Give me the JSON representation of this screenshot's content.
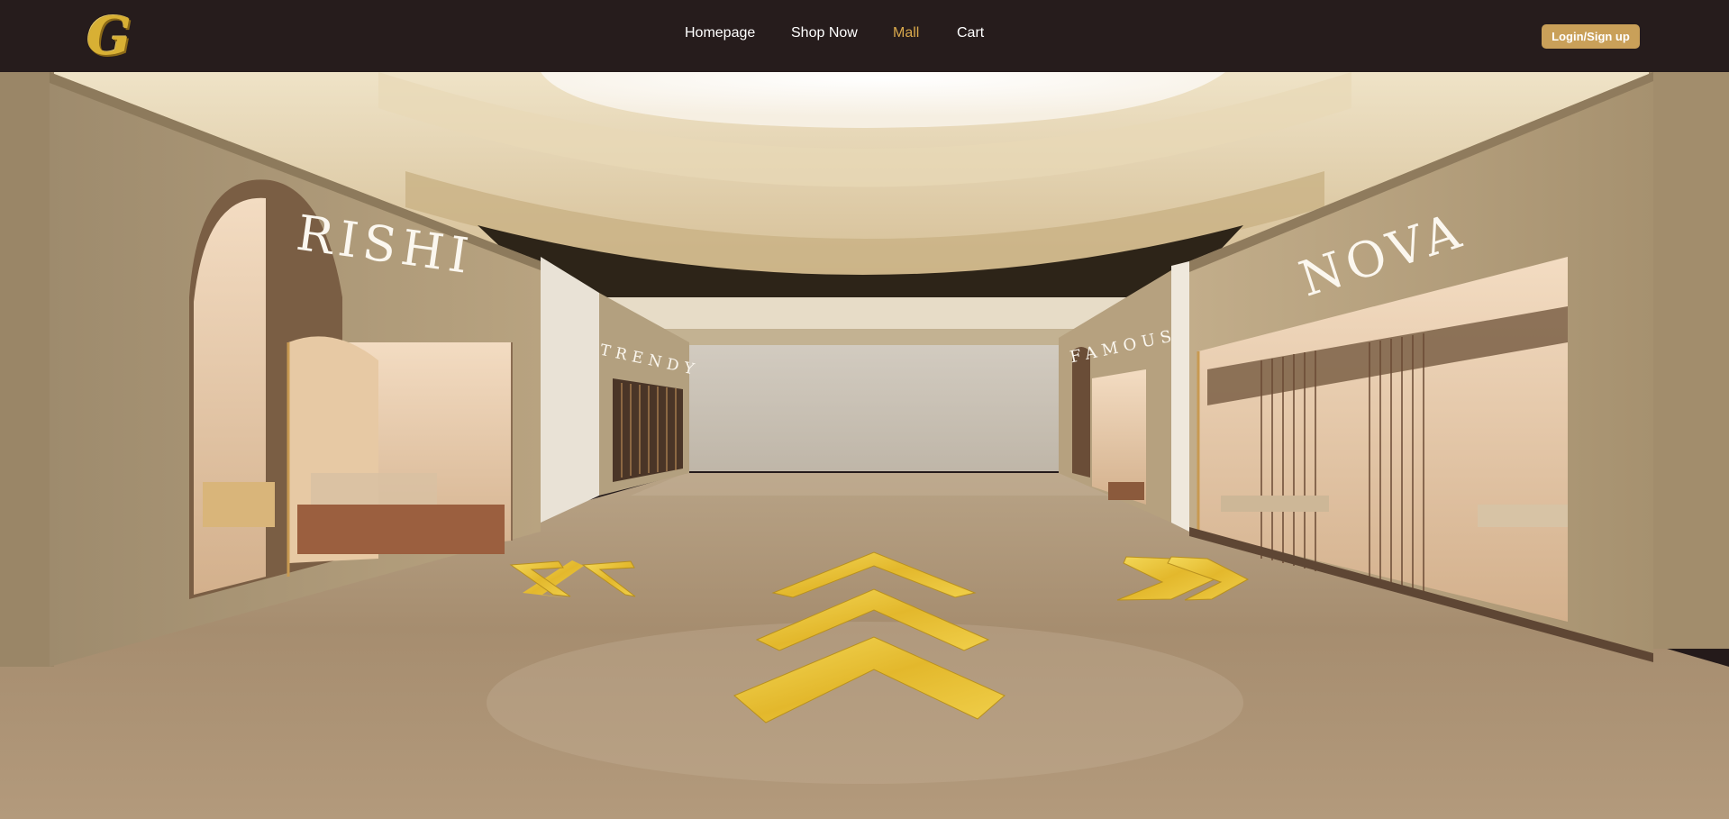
{
  "header": {
    "logo_letter": "G",
    "nav": {
      "homepage": "Homepage",
      "shop_now": "Shop Now",
      "mall": "Mall",
      "cart": "Cart"
    },
    "active_nav": "Mall",
    "login_label": "Login/Sign up"
  },
  "stores": {
    "left_front": "RISHI",
    "left_back": "TRENDY",
    "right_back": "FAMOUS",
    "right_front": "NOVA"
  },
  "colors": {
    "header_bg": "#261c1c",
    "accent_gold": "#c9a059",
    "active_nav": "#d9a94c",
    "arrow_gold": "#e8c33a"
  },
  "controls": {
    "left_arrow_icon": "double-chevron-left-icon",
    "forward_arrow_icon": "triple-chevron-up-icon",
    "right_arrow_icon": "double-chevron-right-icon"
  }
}
